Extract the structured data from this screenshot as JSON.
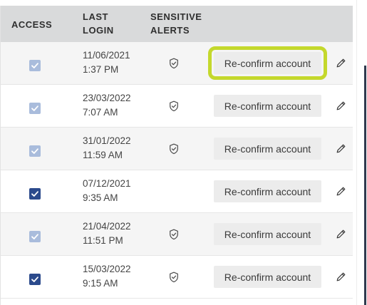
{
  "header": {
    "access": "ACCESS",
    "last_login": [
      "LAST",
      "LOGIN"
    ],
    "sensitive_alerts": [
      "SENSITIVE",
      "ALERTS"
    ]
  },
  "rows": [
    {
      "access_checked": true,
      "access_enabled": false,
      "date": "11/06/2021",
      "time": "1:37 PM",
      "sensitive_alert": true,
      "action_label": "Re-confirm account",
      "focused": true
    },
    {
      "access_checked": true,
      "access_enabled": false,
      "date": "23/03/2022",
      "time": "7:07 AM",
      "sensitive_alert": true,
      "action_label": "Re-confirm account",
      "focused": false
    },
    {
      "access_checked": true,
      "access_enabled": false,
      "date": "31/01/2022",
      "time": "11:59 AM",
      "sensitive_alert": true,
      "action_label": "Re-confirm account",
      "focused": false
    },
    {
      "access_checked": true,
      "access_enabled": true,
      "date": "07/12/2021",
      "time": "9:35 AM",
      "sensitive_alert": false,
      "action_label": "Re-confirm account",
      "focused": false
    },
    {
      "access_checked": true,
      "access_enabled": false,
      "date": "21/04/2022",
      "time": "11:51 PM",
      "sensitive_alert": true,
      "action_label": "Re-confirm account",
      "focused": false
    },
    {
      "access_checked": true,
      "access_enabled": true,
      "date": "15/03/2022",
      "time": "9:15 AM",
      "sensitive_alert": true,
      "action_label": "Re-confirm account",
      "focused": false
    }
  ],
  "icons": {
    "checkbox": "checkbox-checked-icon",
    "alert": "shield-check-icon",
    "edit": "pencil-icon"
  },
  "colors": {
    "header_bg": "#d9dadb",
    "checkbox_enabled": "#2b4a8c",
    "checkbox_disabled": "#a9bcdc",
    "focus_ring": "#c4d82c",
    "button_bg": "#ececec"
  }
}
